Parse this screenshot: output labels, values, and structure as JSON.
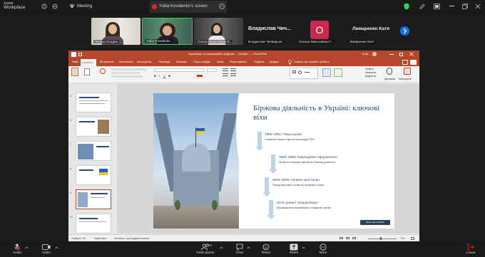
{
  "top_bar": {
    "app_name_line1": "zoom",
    "app_name_line2": "Workplace",
    "meeting_label": "Meeting",
    "screen_share_label": "Yuliia Kovalenko's screen"
  },
  "participants": [
    {
      "name": "Тетяна Осадча"
    },
    {
      "name": "Yuliia Kovalenko"
    },
    {
      "name": "Олена Миколаївна Р..."
    },
    {
      "name": "Владислав Чичварьов"
    },
    {
      "name": "Оксана Миколаївна Г..."
    },
    {
      "name": "Лимаренко Катя"
    }
  ],
  "name_only_tiles": {
    "vladyslav": "Владислав Чич...",
    "lymarenko": "Лимаренко Катя",
    "avatar_letter": "O"
  },
  "powerpoint": {
    "window_title": "Організація та інформаційна Цифрова... • Онлайн ... – PowerPoint",
    "user": "Юлія",
    "tabs": [
      "Файл",
      "Основна",
      "Вставлення",
      "Малювання",
      "Конструктор",
      "Переходи",
      "Анімація",
      "Показ слайдів",
      "Запис",
      "Рецензування",
      "Подання",
      "Довідка"
    ],
    "search_placeholder": "Скажіть, що потрібно зробити",
    "ribbon_right": [
      "Знайти",
      "Замінити",
      "Виділити"
    ],
    "ribbon_right2": [
      "Диктувати",
      "Конструктор"
    ],
    "status_left": "Слайд 9 з 10",
    "status_mid": "Українська",
    "status_notes": "Натисніть, щоб додати нотатки",
    "status_zoom": "70%",
    "thumb_numbers": [
      "5",
      "6",
      "7",
      "8",
      "9",
      "10"
    ]
  },
  "slide": {
    "title": "Біржова діяльність в Україні: ключові віхи",
    "milestones": [
      {
        "heading": "1990–1991: Перші кроки",
        "text": "Створення перших бірж після розпаду СРСР."
      },
      {
        "heading": "1993–1996: Законодавче оформлення",
        "text": "Прийняття базових законів про біржову діяльність."
      },
      {
        "heading": "2000–2008: Активне зростання",
        "text": "Період бурхливого розвитку фондового ринку."
      },
      {
        "heading": "2014–донині: Модернізація",
        "text": "Впровадження європейських стандартів торгівлі."
      }
    ],
    "badge": "Made with GAMMA"
  },
  "bottom_bar": {
    "items": [
      "Audio",
      "Video",
      "Participants",
      "Chat",
      "React",
      "Share",
      "More",
      "Leave"
    ],
    "participants_count": "44"
  },
  "colors": {
    "ppt_accent": "#b7472a",
    "slide_title": "#2b4a7a",
    "zoom_blue": "#0e72ed",
    "green": "#23d959",
    "leave_red": "#e02828",
    "avatar_pink": "#c8294f"
  }
}
